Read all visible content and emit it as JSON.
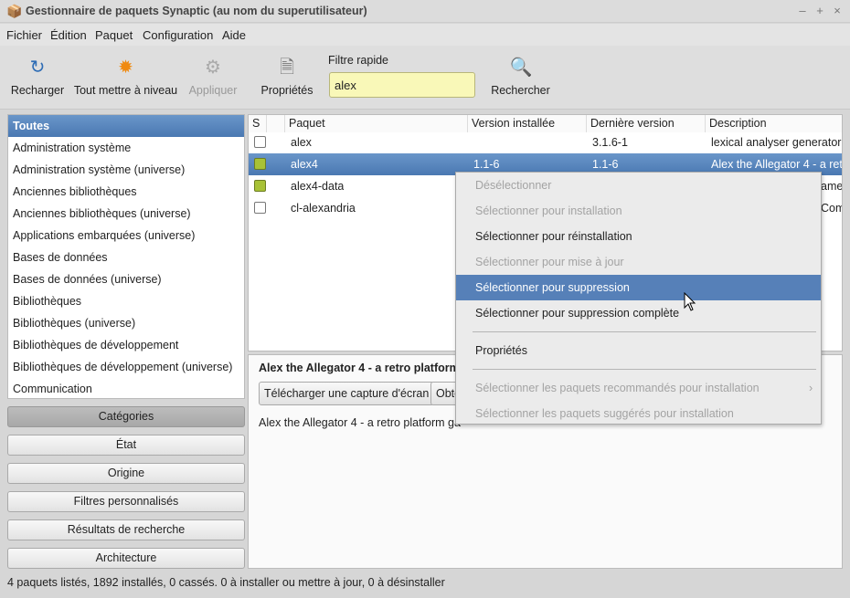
{
  "window": {
    "title": "Gestionnaire de paquets Synaptic  (au nom du superutilisateur)",
    "controls": [
      "–",
      "+",
      "×"
    ]
  },
  "menubar": [
    "Fichier",
    "Édition",
    "Paquet",
    "Configuration",
    "Aide"
  ],
  "toolbar": {
    "reload": "Recharger",
    "upgrade_all": "Tout mettre à niveau",
    "apply": "Appliquer",
    "properties": "Propriétés",
    "quick_filter_label": "Filtre rapide",
    "quick_filter_value": "alex",
    "search": "Rechercher"
  },
  "categories": [
    "Toutes",
    "Administration système",
    "Administration système (universe)",
    "Anciennes bibliothèques",
    "Anciennes bibliothèques (universe)",
    "Applications embarquées (universe)",
    "Bases de données",
    "Bases de données (universe)",
    "Bibliothèques",
    "Bibliothèques (universe)",
    "Bibliothèques de développement",
    "Bibliothèques de développement (universe)",
    "Communication"
  ],
  "filter_buttons": [
    "Catégories",
    "État",
    "Origine",
    "Filtres personnalisés",
    "Résultats de recherche",
    "Architecture"
  ],
  "table": {
    "headers": [
      "S",
      "Paquet",
      "Version installée",
      "Dernière version",
      "Description"
    ],
    "rows": [
      {
        "installed": false,
        "name": "alex",
        "installed_version": "",
        "latest_version": "3.1.6-1",
        "description": "lexical analyser generator f"
      },
      {
        "installed": true,
        "name": "alex4",
        "installed_version": "1.1-6",
        "latest_version": "1.1-6",
        "description": "Alex the Allegator 4 - a retro"
      },
      {
        "installed": true,
        "name": "alex4-data",
        "installed_version": "",
        "latest_version": "",
        "description": "ame"
      },
      {
        "installed": false,
        "name": "cl-alexandria",
        "installed_version": "",
        "latest_version": "",
        "description": "Com"
      }
    ]
  },
  "detail": {
    "title": "Alex the Allegator 4 - a retro platform",
    "screenshot_button": "Télécharger une capture d'écran",
    "changelog_button": "Obte",
    "description": "Alex the Allegator 4 - a retro platform ga"
  },
  "context_menu": {
    "items": [
      {
        "label": "Désélectionner",
        "enabled": false
      },
      {
        "label": "Sélectionner pour installation",
        "enabled": false
      },
      {
        "label": "Sélectionner pour réinstallation",
        "enabled": true
      },
      {
        "label": "Sélectionner pour mise à jour",
        "enabled": false
      },
      {
        "label": "Sélectionner pour suppression",
        "enabled": true,
        "highlighted": true
      },
      {
        "label": "Sélectionner pour suppression complète",
        "enabled": true
      },
      {
        "label": "Propriétés",
        "enabled": true
      },
      {
        "label": "Sélectionner les paquets recommandés pour installation",
        "enabled": false,
        "submenu": true
      },
      {
        "label": "Sélectionner les paquets suggérés pour installation",
        "enabled": false
      }
    ]
  },
  "status": "4 paquets listés, 1892 installés, 0 cassés. 0 à installer ou mettre à jour, 0 à désinstaller",
  "colors": {
    "selection": "#4f7fb8",
    "filter_bg": "#f9f8b8",
    "installed": "#a8c236"
  }
}
